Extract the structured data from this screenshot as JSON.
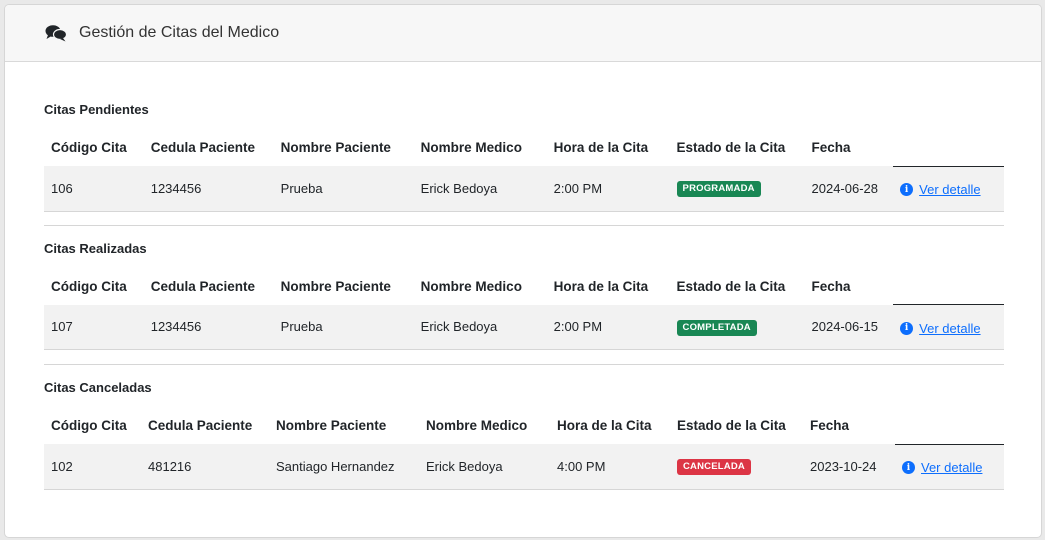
{
  "header": {
    "title": "Gestión de Citas del Medico",
    "icon": "comments-icon"
  },
  "columns": [
    "Código Cita",
    "Cedula Paciente",
    "Nombre Paciente",
    "Nombre Medico",
    "Hora de la Cita",
    "Estado de la Cita",
    "Fecha"
  ],
  "detail_label": "Ver detalle",
  "sections": [
    {
      "title": "Citas Pendientes",
      "rows": [
        {
          "codigo": "106",
          "cedula": "1234456",
          "paciente": "Prueba",
          "medico": "Erick Bedoya",
          "hora": "2:00 PM",
          "estado": "PROGRAMADA",
          "fecha": "2024-06-28"
        }
      ]
    },
    {
      "title": "Citas Realizadas",
      "rows": [
        {
          "codigo": "107",
          "cedula": "1234456",
          "paciente": "Prueba",
          "medico": "Erick Bedoya",
          "hora": "2:00 PM",
          "estado": "COMPLETADA",
          "fecha": "2024-06-15"
        }
      ]
    },
    {
      "title": "Citas Canceladas",
      "rows": [
        {
          "codigo": "102",
          "cedula": "481216",
          "paciente": "Santiago Hernandez",
          "medico": "Erick Bedoya",
          "hora": "4:00 PM",
          "estado": "CANCELADA",
          "fecha": "2023-10-24"
        }
      ]
    }
  ],
  "colors": {
    "programada": "#198754",
    "completada": "#198754",
    "cancelada": "#dc3545",
    "link": "#0d6efd"
  }
}
